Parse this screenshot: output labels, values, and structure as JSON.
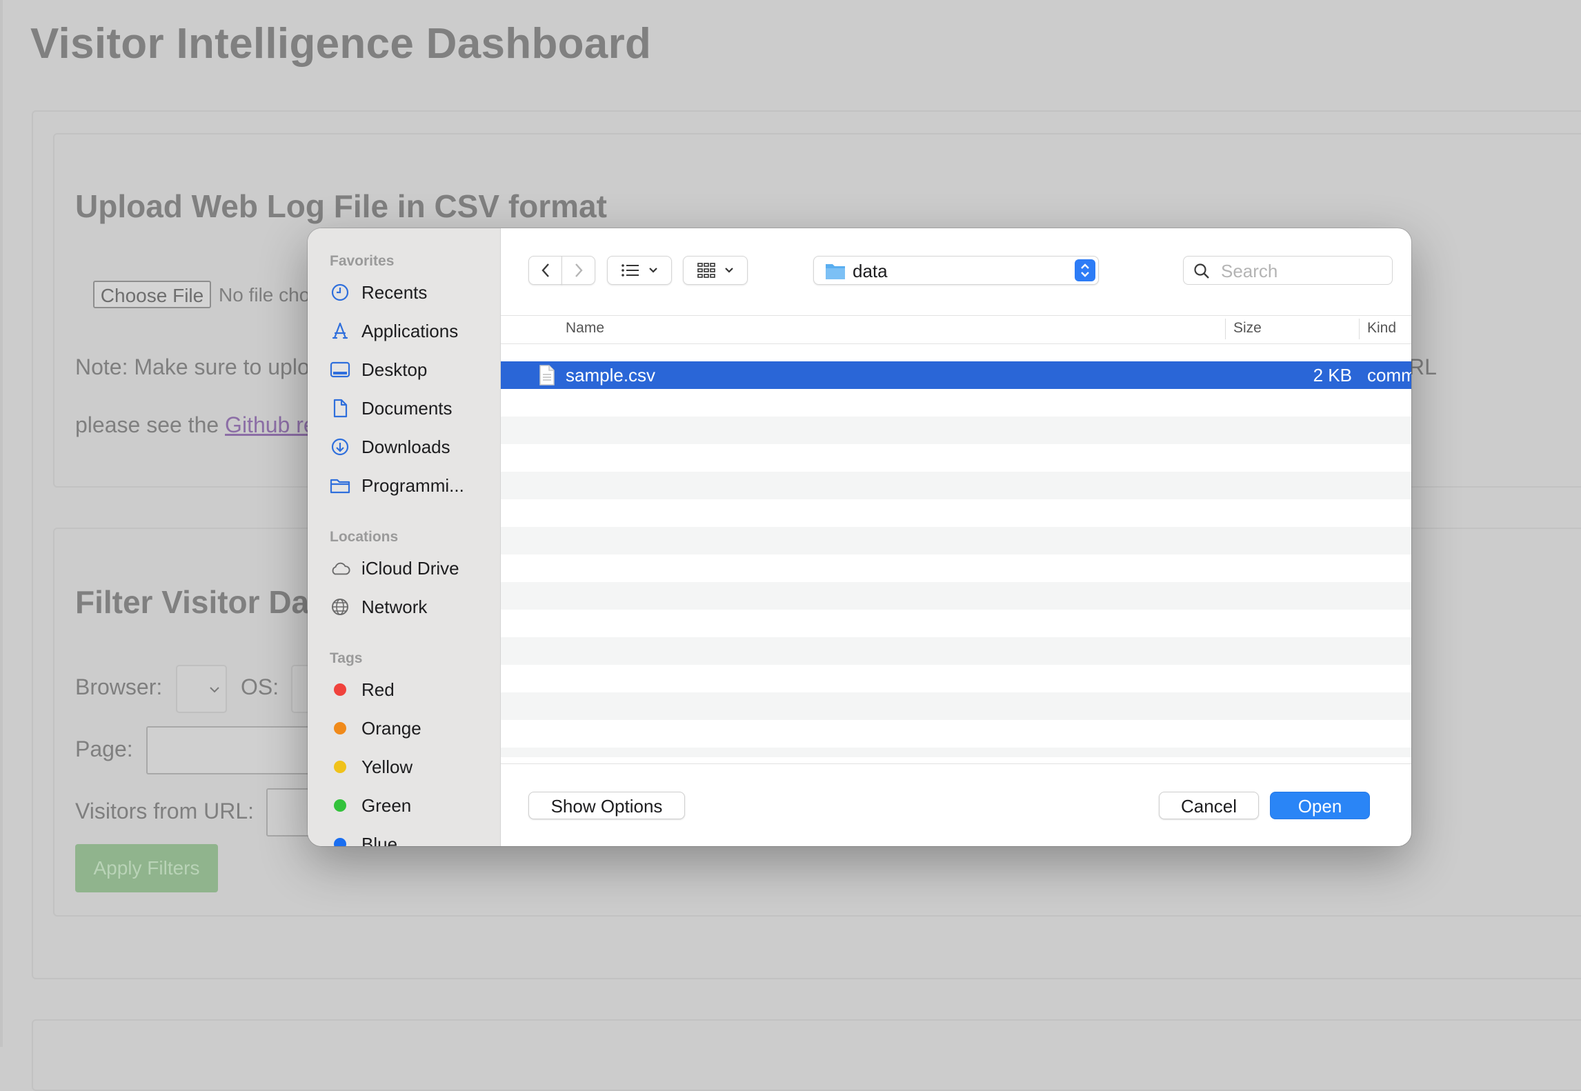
{
  "page": {
    "title": "Visitor Intelligence Dashboard",
    "upload": {
      "heading": "Upload Web Log File in CSV format",
      "choose_file": "Choose File",
      "no_file": "No file cho",
      "note_start": "Note: Make sure to uplo",
      "note_end": "RL",
      "please_see": "please see the ",
      "github_link": "Github re"
    },
    "filter": {
      "heading": "Filter Visitor Da",
      "browser_label": "Browser:",
      "os_label": "OS:",
      "page_label": "Page:",
      "visitors_label": "Visitors from URL:",
      "apply": "Apply Filters"
    }
  },
  "dialog": {
    "sidebar": {
      "favorites_heading": "Favorites",
      "favorites": [
        {
          "label": "Recents",
          "icon": "clock-icon"
        },
        {
          "label": "Applications",
          "icon": "applications-icon"
        },
        {
          "label": "Desktop",
          "icon": "desktop-icon"
        },
        {
          "label": "Documents",
          "icon": "document-icon"
        },
        {
          "label": "Downloads",
          "icon": "download-icon"
        },
        {
          "label": "Programmi...",
          "icon": "folder-icon"
        }
      ],
      "locations_heading": "Locations",
      "locations": [
        {
          "label": "iCloud Drive",
          "icon": "cloud-icon"
        },
        {
          "label": "Network",
          "icon": "globe-icon"
        }
      ],
      "tags_heading": "Tags",
      "tags": [
        {
          "label": "Red",
          "color": "#f0423c"
        },
        {
          "label": "Orange",
          "color": "#f08a1a"
        },
        {
          "label": "Yellow",
          "color": "#f0c21a"
        },
        {
          "label": "Green",
          "color": "#33c23b"
        },
        {
          "label": "Blue",
          "color": "#1a6ef0"
        }
      ]
    },
    "toolbar": {
      "path": "data",
      "search_placeholder": "Search"
    },
    "columns": {
      "name": "Name",
      "size": "Size",
      "kind": "Kind"
    },
    "files": [
      {
        "name": "sample.csv",
        "size": "2 KB",
        "kind": "comma-separated values",
        "selected": true
      }
    ],
    "buttons": {
      "show_options": "Show Options",
      "cancel": "Cancel",
      "open": "Open"
    }
  }
}
